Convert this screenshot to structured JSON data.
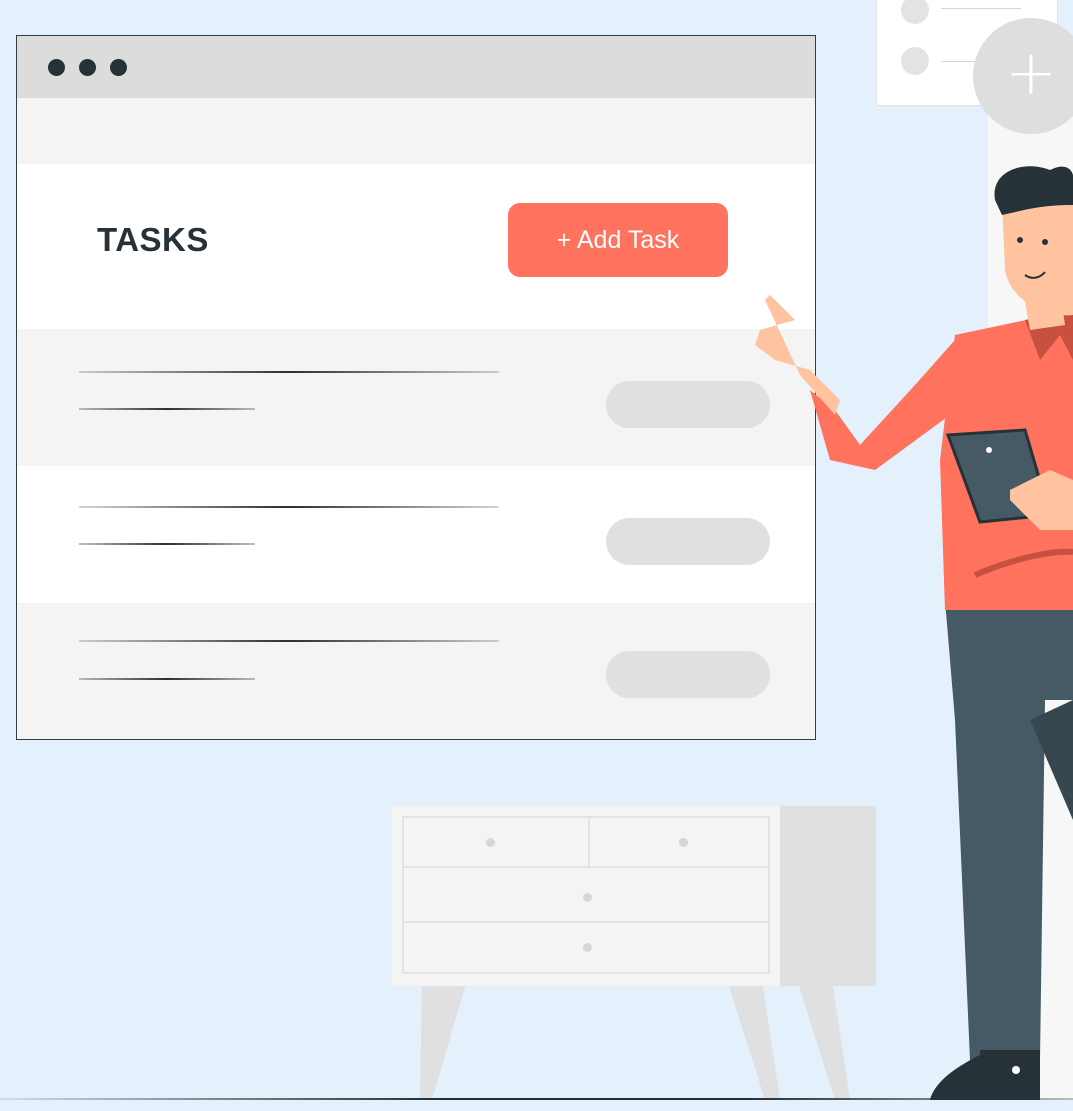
{
  "window": {
    "controls": [
      "window-dot",
      "window-dot",
      "window-dot"
    ]
  },
  "header": {
    "title": "TASKS",
    "add_button_label": "+ Add Task"
  },
  "task_rows": [
    {
      "status": "placeholder"
    },
    {
      "status": "placeholder"
    },
    {
      "status": "placeholder"
    }
  ],
  "fab": {
    "icon": "plus-icon",
    "label": "+"
  },
  "colors": {
    "background": "#e4f0fc",
    "accent": "#ff725e",
    "dark": "#263238",
    "window_bg": "#f4f4f4",
    "placeholder_gray": "#e0e0e0"
  }
}
